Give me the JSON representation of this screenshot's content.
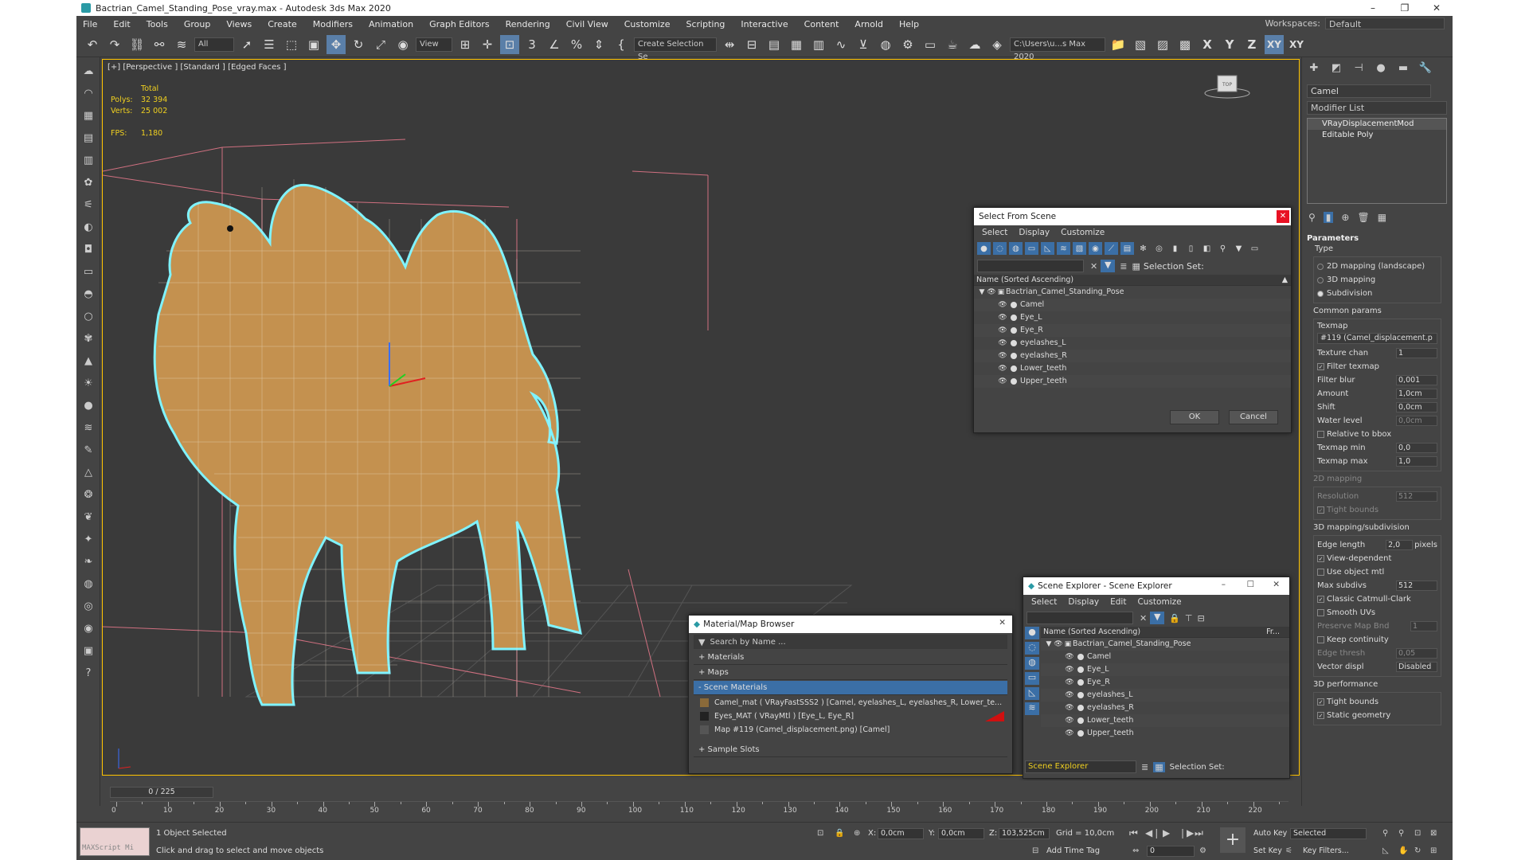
{
  "title": "Bactrian_Camel_Standing_Pose_vray.max - Autodesk 3ds Max 2020",
  "menu": [
    "File",
    "Edit",
    "Tools",
    "Group",
    "Views",
    "Create",
    "Modifiers",
    "Animation",
    "Graph Editors",
    "Rendering",
    "Civil View",
    "Customize",
    "Scripting",
    "Interactive",
    "Content",
    "Arnold",
    "Help"
  ],
  "workspace": {
    "label": "Workspaces:",
    "value": "Default"
  },
  "toolbar": {
    "filter": "All",
    "view": "View",
    "selection_set": "Create Selection Se",
    "path": "C:\\Users\\u...s Max 2020",
    "axes": [
      "X",
      "Y",
      "Z",
      "XY",
      "XY"
    ]
  },
  "viewport": {
    "label": "[+] [Perspective ] [Standard ] [Edged Faces ]",
    "stats": {
      "total": "Total",
      "polys_label": "Polys:",
      "polys": "32 394",
      "verts_label": "Verts:",
      "verts": "25 002",
      "fps_label": "FPS:",
      "fps": "1,180"
    },
    "viewcube": "TOP"
  },
  "command_panel": {
    "object_name": "Camel",
    "modifier_list": "Modifier List",
    "stack": [
      "VRayDisplacementMod",
      "Editable Poly"
    ],
    "params": {
      "header": "Parameters",
      "type_label": "Type",
      "types": [
        "2D mapping (landscape)",
        "3D mapping",
        "Subdivision"
      ],
      "common": "Common params",
      "texmap_label": "Texmap",
      "texmap": "#119 (Camel_displacement.p",
      "texture_chan_label": "Texture chan",
      "texture_chan": "1",
      "filter_texmap": "Filter texmap",
      "filter_blur_label": "Filter blur",
      "filter_blur": "0,001",
      "amount_label": "Amount",
      "amount": "1,0cm",
      "shift_label": "Shift",
      "shift": "0,0cm",
      "water_label": "Water level",
      "water": "0,0cm",
      "relative": "Relative to bbox",
      "texmap_min_label": "Texmap min",
      "texmap_min": "0,0",
      "texmap_max_label": "Texmap max",
      "texmap_max": "1,0",
      "mapping2d": "2D mapping",
      "resolution_label": "Resolution",
      "resolution": "512",
      "tight_bounds": "Tight bounds",
      "mapping3d": "3D mapping/subdivision",
      "edge_length_label": "Edge length",
      "edge_length": "2,0",
      "pixels": "pixels",
      "view_dependent": "View-dependent",
      "use_object_mtl": "Use object mtl",
      "max_subdivs_label": "Max subdivs",
      "max_subdivs": "512",
      "catmull": "Classic Catmull-Clark",
      "smooth_uvs": "Smooth UVs",
      "preserve_label": "Preserve Map Bnd",
      "preserve": "1",
      "keep_continuity": "Keep continuity",
      "edge_thresh_label": "Edge thresh",
      "edge_thresh": "0,05",
      "vector_label": "Vector displ",
      "vector": "Disabled",
      "perf": "3D performance",
      "tight_bounds2": "Tight bounds",
      "static_geometry": "Static geometry"
    }
  },
  "select_from_scene": {
    "title": "Select From Scene",
    "menu": [
      "Select",
      "Display",
      "Customize"
    ],
    "selection_set": "Selection Set:",
    "header": "Name (Sorted Ascending)",
    "root": "Bactrian_Camel_Standing_Pose",
    "items": [
      "Camel",
      "Eye_L",
      "Eye_R",
      "eyelashes_L",
      "eyelashes_R",
      "Lower_teeth",
      "Upper_teeth"
    ],
    "ok": "OK",
    "cancel": "Cancel"
  },
  "scene_explorer": {
    "title": "Scene Explorer - Scene Explorer",
    "menu": [
      "Select",
      "Display",
      "Edit",
      "Customize"
    ],
    "header": "Name (Sorted Ascending)",
    "header2": "Fr...",
    "root": "Bactrian_Camel_Standing_Pose",
    "items": [
      "Camel",
      "Eye_L",
      "Eye_R",
      "eyelashes_L",
      "eyelashes_R",
      "Lower_teeth",
      "Upper_teeth"
    ],
    "footer_name": "Scene Explorer",
    "selection_set": "Selection Set:"
  },
  "material_browser": {
    "title": "Material/Map Browser",
    "search": "Search by Name ...",
    "sections": [
      "+ Materials",
      "+ Maps",
      "- Scene Materials"
    ],
    "rows": [
      "Camel_mat  ( VRayFastSSS2 )  [Camel, eyelashes_L, eyelashes_R, Lower_te...",
      "Eyes_MAT  ( VRayMtl )  [Eye_L, Eye_R]",
      "Map #119 (Camel_displacement.png)  [Camel]"
    ],
    "sample": "+ Sample Slots"
  },
  "timeline": {
    "frame": "0 / 225",
    "ticks": [
      "0",
      "10",
      "20",
      "30",
      "40",
      "50",
      "60",
      "70",
      "80",
      "90",
      "100",
      "110",
      "120",
      "130",
      "140",
      "150",
      "160",
      "170",
      "180",
      "190",
      "200",
      "210",
      "220"
    ]
  },
  "status": {
    "maxscript": "MAXScript Mi",
    "selected": "1 Object Selected",
    "hint": "Click and drag to select and move objects",
    "x_label": "X:",
    "x": "0,0cm",
    "y_label": "Y:",
    "y": "0,0cm",
    "z_label": "Z:",
    "z": "103,525cm",
    "grid": "Grid = 10,0cm",
    "add_time_tag": "Add Time Tag",
    "auto_key": "Auto Key",
    "selected_dd": "Selected",
    "set_key": "Set Key",
    "key_filters": "Key Filters...",
    "frame": "0"
  }
}
